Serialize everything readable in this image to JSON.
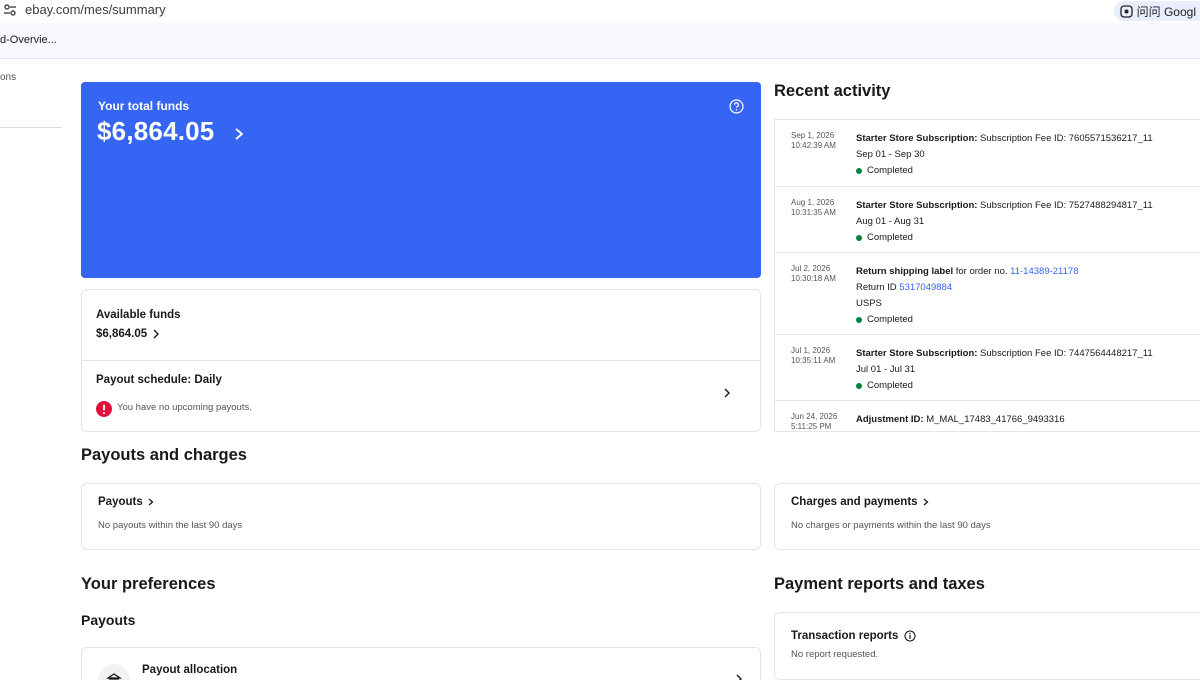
{
  "browser": {
    "url": "ebay.com/mes/summary",
    "right_text": "问问 Googl",
    "bookmark": "d-Overvie..."
  },
  "left_nav": {
    "item": "ons"
  },
  "funds": {
    "label": "Your total funds",
    "amount": "$6,864.05",
    "available_label": "Available funds",
    "available_value": "$6,864.05",
    "schedule_label": "Payout schedule: Daily",
    "no_upcoming": "You have no upcoming payouts."
  },
  "recent_activity": {
    "title": "Recent activity",
    "items": [
      {
        "date": "Sep 1, 2026",
        "time": "10:42:39 AM",
        "title": "Starter Store Subscription:",
        "title_rest": " Subscription Fee ID: 7605571536217_11",
        "line2": "Sep 01 - Sep 30",
        "status": "Completed"
      },
      {
        "date": "Aug 1, 2026",
        "time": "10:31:35 AM",
        "title": "Starter Store Subscription:",
        "title_rest": " Subscription Fee ID: 7527488294817_11",
        "line2": "Aug 01 - Aug 31",
        "status": "Completed"
      },
      {
        "date": "Jul 2, 2026",
        "time": "10:30:18 AM",
        "title": "Return shipping label",
        "title_mid": " for order no. ",
        "order_link": "11-14389-21178",
        "return_prefix": "Return ID ",
        "return_link": "5317049884",
        "line3": "USPS",
        "status": "Completed"
      },
      {
        "date": "Jul 1, 2026",
        "time": "10:35:11 AM",
        "title": "Starter Store Subscription:",
        "title_rest": " Subscription Fee ID: 7447564448217_11",
        "line2": "Jul 01 - Jul 31",
        "status": "Completed"
      },
      {
        "date": "Jun 24, 2026",
        "time": "5:11:25 PM",
        "title": "Adjustment ID:",
        "title_rest": " M_MAL_17483_41766_9493316"
      }
    ]
  },
  "payouts_charges": {
    "title": "Payouts and charges",
    "payouts_label": "Payouts",
    "payouts_sub": "No payouts within the last 90 days",
    "charges_label": "Charges and payments",
    "charges_sub": "No charges or payments within the last 90 days"
  },
  "preferences": {
    "title": "Your preferences",
    "payouts_subtitle": "Payouts",
    "allocation_label": "Payout allocation"
  },
  "reports": {
    "title": "Payment reports and taxes",
    "transaction_label": "Transaction reports",
    "transaction_sub": "No report requested."
  },
  "colors": {
    "accent": "#3665f3",
    "success": "#05823f",
    "error": "#e0103a"
  }
}
